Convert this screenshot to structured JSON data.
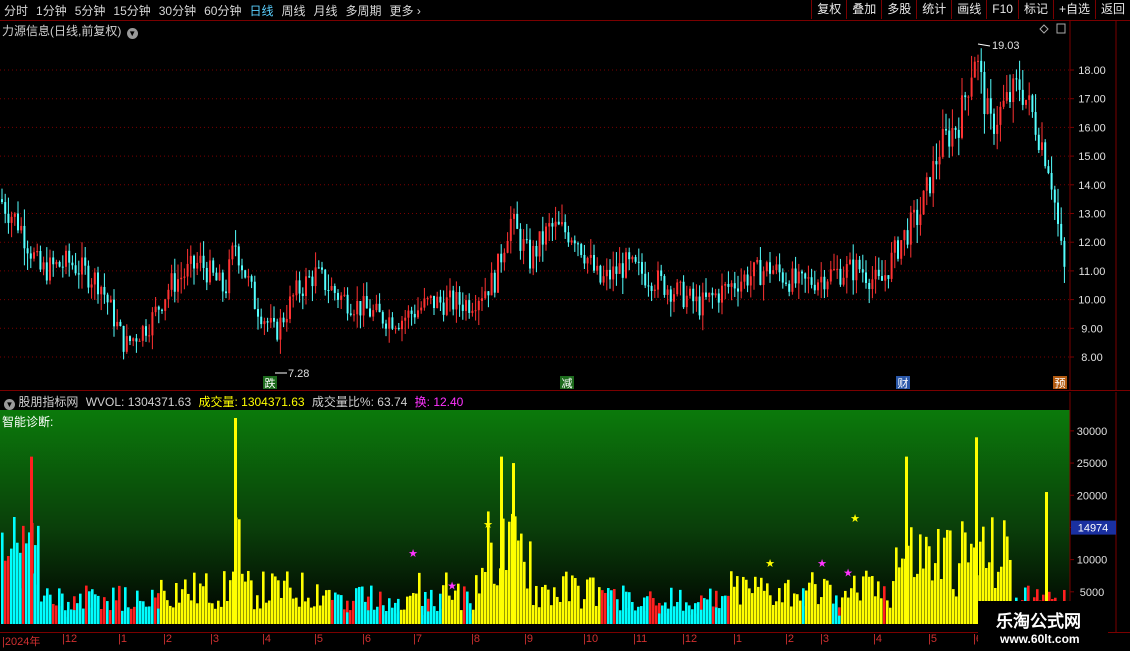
{
  "toolbar": {
    "periods": [
      "分时",
      "1分钟",
      "5分钟",
      "15分钟",
      "30分钟",
      "60分钟",
      "日线",
      "周线",
      "月线",
      "多周期",
      "更多"
    ],
    "active_period": "日线",
    "more_arrow": "›",
    "buttons": [
      "复权",
      "叠加",
      "多股",
      "统计",
      "画线",
      "F10",
      "标记",
      "+自选",
      "返回"
    ]
  },
  "price_panel": {
    "title": "力源信息(日线,前复权)",
    "y_ticks": [
      "18.00",
      "17.00",
      "16.00",
      "15.00",
      "14.00",
      "13.00",
      "12.00",
      "11.00",
      "10.00",
      "9.00",
      "8.00"
    ],
    "high_label": "19.03",
    "low_label": "7.28",
    "markers": [
      "跌",
      "减",
      "财",
      "预"
    ],
    "colors": {
      "up": "#ff3232",
      "down": "#54ffff",
      "grid": "#7a0000"
    }
  },
  "volume_panel": {
    "indicator_name": "股朋指标网",
    "wvol_label": "WVOL:",
    "wvol_value": "1304371.63",
    "vol_label": "成交量:",
    "vol_value": "1304371.63",
    "ratio_label": "成交量比%:",
    "ratio_value": "63.74",
    "turnover_label": "换:",
    "turnover_value": "12.40",
    "diagnosis": "智能诊断:",
    "y_ticks": [
      "30000",
      "25000",
      "20000",
      "15000",
      "10000",
      "5000"
    ],
    "current_value": "14974",
    "colors": {
      "yellow": "#ffff00",
      "cyan": "#00ffff",
      "red": "#ff2020",
      "magenta": "#ff33ff"
    }
  },
  "time_axis": {
    "labels": [
      "2024年",
      "12",
      "1",
      "2",
      "3",
      "4",
      "5",
      "6",
      "7",
      "8",
      "9",
      "10",
      "11",
      "12",
      "1",
      "2",
      "3",
      "4",
      "5",
      "6"
    ]
  },
  "watermark": {
    "line1": "乐淘公式网",
    "line2": "www.60lt.com"
  }
}
